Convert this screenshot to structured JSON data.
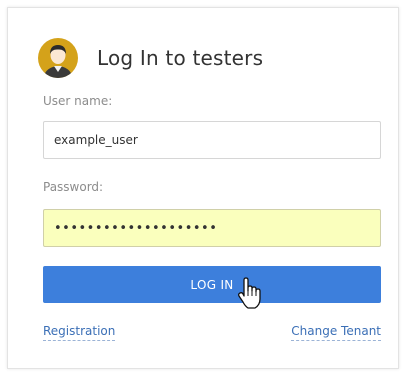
{
  "header": {
    "title": "Log In to testers",
    "avatar_icon": "user-avatar-icon"
  },
  "form": {
    "username_label": "User name:",
    "username_value": "example_user",
    "password_label": "Password:",
    "password_value": "••••••••••••••••••••",
    "password_field_color": "#faffbd"
  },
  "actions": {
    "login_label": "LOG IN",
    "login_color": "#3d7fdc",
    "registration_label": "Registration",
    "change_tenant_label": "Change Tenant",
    "cursor_icon": "hand-pointer-icon"
  }
}
